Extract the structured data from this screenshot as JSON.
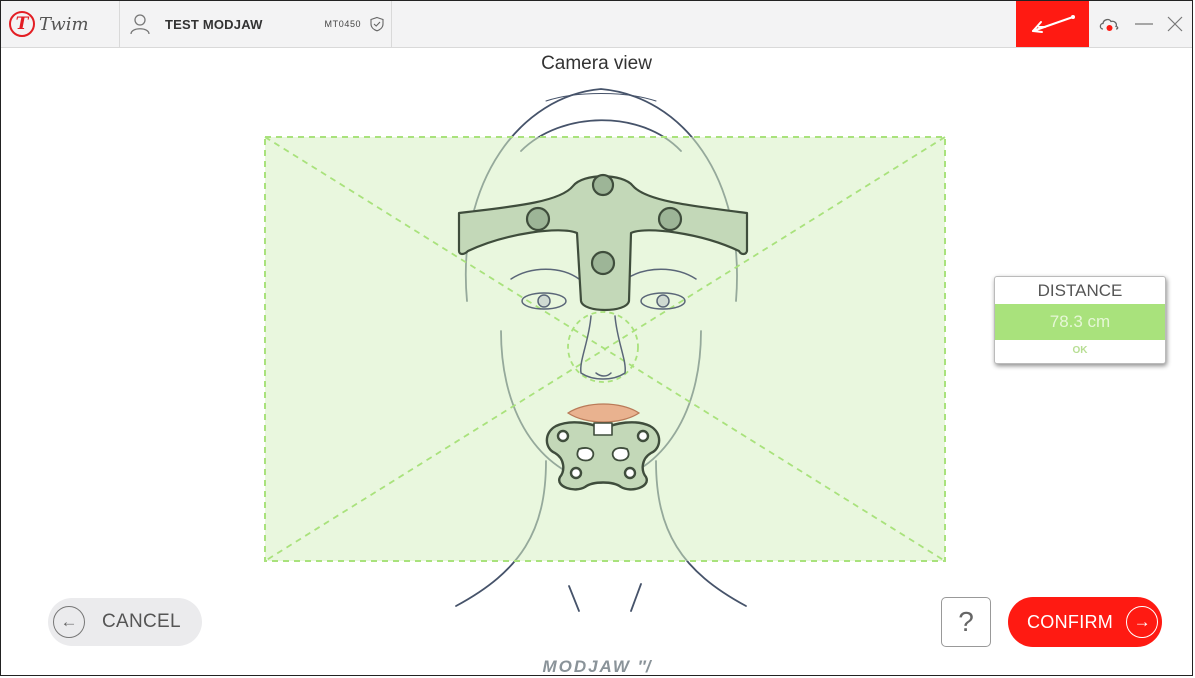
{
  "app": {
    "logo_letter": "T",
    "name": "Twim"
  },
  "header": {
    "patient_name": "TEST MODJAW",
    "device_code": "MT0450"
  },
  "page": {
    "title": "Camera view"
  },
  "distance_panel": {
    "label": "DISTANCE",
    "value": "78.3 cm",
    "status": "OK"
  },
  "buttons": {
    "cancel": "CANCEL",
    "help": "?",
    "confirm": "CONFIRM"
  },
  "footer": {
    "brand": "MODJAW"
  },
  "icons": {
    "user": "user-icon",
    "shield": "shield-check-icon",
    "tool": "jaw-tracker-icon",
    "cloud": "cloud-icon",
    "minimize": "minimize-icon",
    "close": "close-icon",
    "arrow_left": "arrow-left-icon",
    "arrow_right": "arrow-right-icon"
  },
  "colors": {
    "accent": "#ff1a12",
    "frame_fill": "#e3f5d4",
    "frame_line": "#a9e27c",
    "ok_green": "#a9e27c"
  }
}
